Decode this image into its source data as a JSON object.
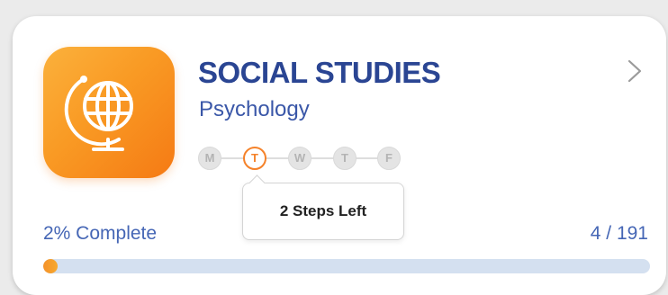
{
  "course": {
    "title": "SOCIAL STUDIES",
    "subtitle": "Psychology",
    "icon": "globe-icon"
  },
  "week": {
    "days": [
      {
        "label": "M",
        "state": "inactive"
      },
      {
        "label": "T",
        "state": "active"
      },
      {
        "label": "W",
        "state": "inactive"
      },
      {
        "label": "T",
        "state": "inactive"
      },
      {
        "label": "F",
        "state": "inactive"
      }
    ]
  },
  "tooltip": {
    "text": "2 Steps Left"
  },
  "progress": {
    "label": "2% Complete",
    "count": "4 / 191",
    "fraction": 0.02
  },
  "colors": {
    "title": "#2a4593",
    "accent": "#f5822a",
    "progress_track": "#d4e0f0"
  }
}
